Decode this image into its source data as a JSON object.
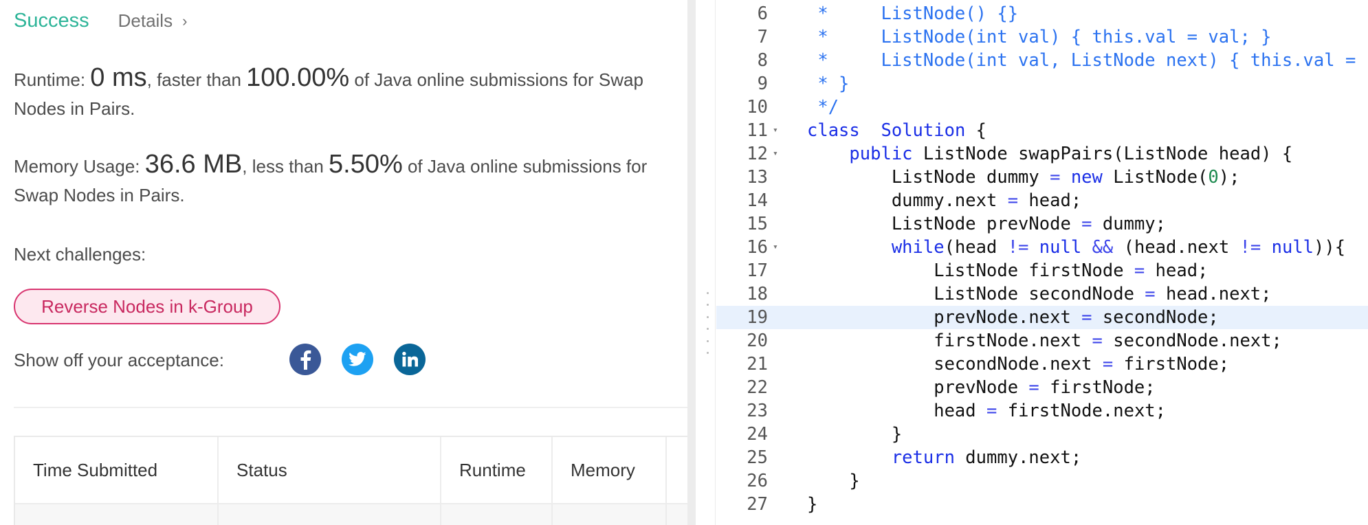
{
  "result": {
    "status": "Success",
    "details_label": "Details",
    "details_chevron": "›"
  },
  "runtime": {
    "label": "Runtime: ",
    "value": "0 ms",
    "middle": ", faster than ",
    "percent": "100.00%",
    "suffix": " of Java online submissions for Swap Nodes in Pairs."
  },
  "memory": {
    "label": "Memory Usage: ",
    "value": "36.6 MB",
    "middle": ", less than ",
    "percent": "5.50%",
    "suffix": " of Java online submissions for Swap Nodes in Pairs."
  },
  "next": {
    "label": "Next challenges:",
    "challenge": "Reverse Nodes in k-Group"
  },
  "share": {
    "label": "Show off your acceptance:",
    "icons": [
      "facebook-icon",
      "twitter-icon",
      "linkedin-icon"
    ],
    "colors": {
      "facebook": "#3a5897",
      "twitter": "#1da1f2",
      "linkedin": "#0a6698"
    }
  },
  "table": {
    "headers": [
      "Time Submitted",
      "Status",
      "Runtime",
      "Memory"
    ]
  },
  "colors": {
    "success": "#2db498",
    "pill_border": "#d8346f",
    "keyword": "#1a2ee6",
    "comment": "#2b72f0",
    "highlight_line": "#e8f1fd"
  },
  "editor": {
    "highlighted_line": 19,
    "lines": [
      {
        "n": "6",
        "fold": false,
        "tokens": [
          [
            "cm",
            " *     ListNode() {}"
          ]
        ]
      },
      {
        "n": "7",
        "fold": false,
        "tokens": [
          [
            "cm",
            " *     ListNode(int val) { this.val = val; }"
          ]
        ]
      },
      {
        "n": "8",
        "fold": false,
        "tokens": [
          [
            "cm",
            " *     ListNode(int val, ListNode next) { this.val ="
          ]
        ]
      },
      {
        "n": "9",
        "fold": false,
        "tokens": [
          [
            "cm",
            " * }"
          ]
        ]
      },
      {
        "n": "10",
        "fold": false,
        "tokens": [
          [
            "cm",
            " */"
          ]
        ]
      },
      {
        "n": "11",
        "fold": true,
        "tokens": [
          [
            "kw",
            "class"
          ],
          [
            "",
            "  "
          ],
          [
            "kw",
            "Solution"
          ],
          [
            "",
            " {"
          ]
        ]
      },
      {
        "n": "12",
        "fold": true,
        "tokens": [
          [
            "",
            "    "
          ],
          [
            "kw",
            "public"
          ],
          [
            "",
            " ListNode swapPairs(ListNode head) {"
          ]
        ]
      },
      {
        "n": "13",
        "fold": false,
        "tokens": [
          [
            "",
            "        ListNode dummy "
          ],
          [
            "op",
            "="
          ],
          [
            "",
            " "
          ],
          [
            "kw",
            "new"
          ],
          [
            "",
            " ListNode("
          ],
          [
            "num",
            "0"
          ],
          [
            "",
            ");"
          ]
        ]
      },
      {
        "n": "14",
        "fold": false,
        "tokens": [
          [
            "",
            "        dummy.next "
          ],
          [
            "op",
            "="
          ],
          [
            "",
            " head;"
          ]
        ]
      },
      {
        "n": "15",
        "fold": false,
        "tokens": [
          [
            "",
            "        ListNode prevNode "
          ],
          [
            "op",
            "="
          ],
          [
            "",
            " dummy;"
          ]
        ]
      },
      {
        "n": "16",
        "fold": true,
        "tokens": [
          [
            "",
            "        "
          ],
          [
            "kw",
            "while"
          ],
          [
            "",
            "(head "
          ],
          [
            "op",
            "!="
          ],
          [
            "",
            " "
          ],
          [
            "kw",
            "null"
          ],
          [
            "",
            " "
          ],
          [
            "op",
            "&&"
          ],
          [
            "",
            " (head.next "
          ],
          [
            "op",
            "!="
          ],
          [
            "",
            " "
          ],
          [
            "kw",
            "null"
          ],
          [
            "",
            "))"
          ],
          [
            "",
            "{"
          ]
        ]
      },
      {
        "n": "17",
        "fold": false,
        "tokens": [
          [
            "",
            "            ListNode firstNode "
          ],
          [
            "op",
            "="
          ],
          [
            "",
            " head;"
          ]
        ]
      },
      {
        "n": "18",
        "fold": false,
        "tokens": [
          [
            "",
            "            ListNode secondNode "
          ],
          [
            "op",
            "="
          ],
          [
            "",
            " head.next;"
          ]
        ]
      },
      {
        "n": "19",
        "fold": false,
        "tokens": [
          [
            "",
            "            prevNode.next "
          ],
          [
            "op",
            "="
          ],
          [
            "",
            " secondNode;"
          ]
        ]
      },
      {
        "n": "20",
        "fold": false,
        "tokens": [
          [
            "",
            "            firstNode.next "
          ],
          [
            "op",
            "="
          ],
          [
            "",
            " secondNode.next;"
          ]
        ]
      },
      {
        "n": "21",
        "fold": false,
        "tokens": [
          [
            "",
            "            secondNode.next "
          ],
          [
            "op",
            "="
          ],
          [
            "",
            " firstNode;"
          ]
        ]
      },
      {
        "n": "22",
        "fold": false,
        "tokens": [
          [
            "",
            "            prevNode "
          ],
          [
            "op",
            "="
          ],
          [
            "",
            " firstNode;"
          ]
        ]
      },
      {
        "n": "23",
        "fold": false,
        "tokens": [
          [
            "",
            "            head "
          ],
          [
            "op",
            "="
          ],
          [
            "",
            " firstNode.next;"
          ]
        ]
      },
      {
        "n": "24",
        "fold": false,
        "tokens": [
          [
            "",
            "        }"
          ]
        ]
      },
      {
        "n": "25",
        "fold": false,
        "tokens": [
          [
            "",
            "        "
          ],
          [
            "kw",
            "return"
          ],
          [
            "",
            " dummy.next;"
          ]
        ]
      },
      {
        "n": "26",
        "fold": false,
        "tokens": [
          [
            "",
            "    }"
          ]
        ]
      },
      {
        "n": "27",
        "fold": false,
        "tokens": [
          [
            "",
            "}"
          ]
        ]
      }
    ]
  }
}
